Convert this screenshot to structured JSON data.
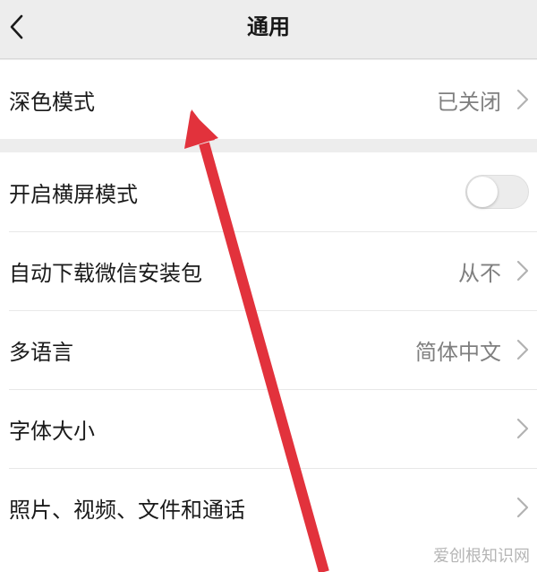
{
  "header": {
    "title": "通用",
    "back_icon": "chevron-left-icon"
  },
  "dark_mode": {
    "label": "深色模式",
    "value": "已关闭"
  },
  "settings": {
    "landscape": {
      "label": "开启横屏模式",
      "toggle_on": false
    },
    "auto_download": {
      "label": "自动下载微信安装包",
      "value": "从不"
    },
    "language": {
      "label": "多语言",
      "value": "简体中文"
    },
    "font_size": {
      "label": "字体大小",
      "value": ""
    },
    "media": {
      "label": "照片、视频、文件和通话",
      "value": ""
    }
  },
  "annotation": {
    "color": "#e2323c"
  },
  "watermark": "爱创根知识网",
  "colors": {
    "background": "#ededed",
    "card": "#ffffff",
    "text_primary": "#1a1a1a",
    "text_secondary": "#7f7f7f"
  }
}
